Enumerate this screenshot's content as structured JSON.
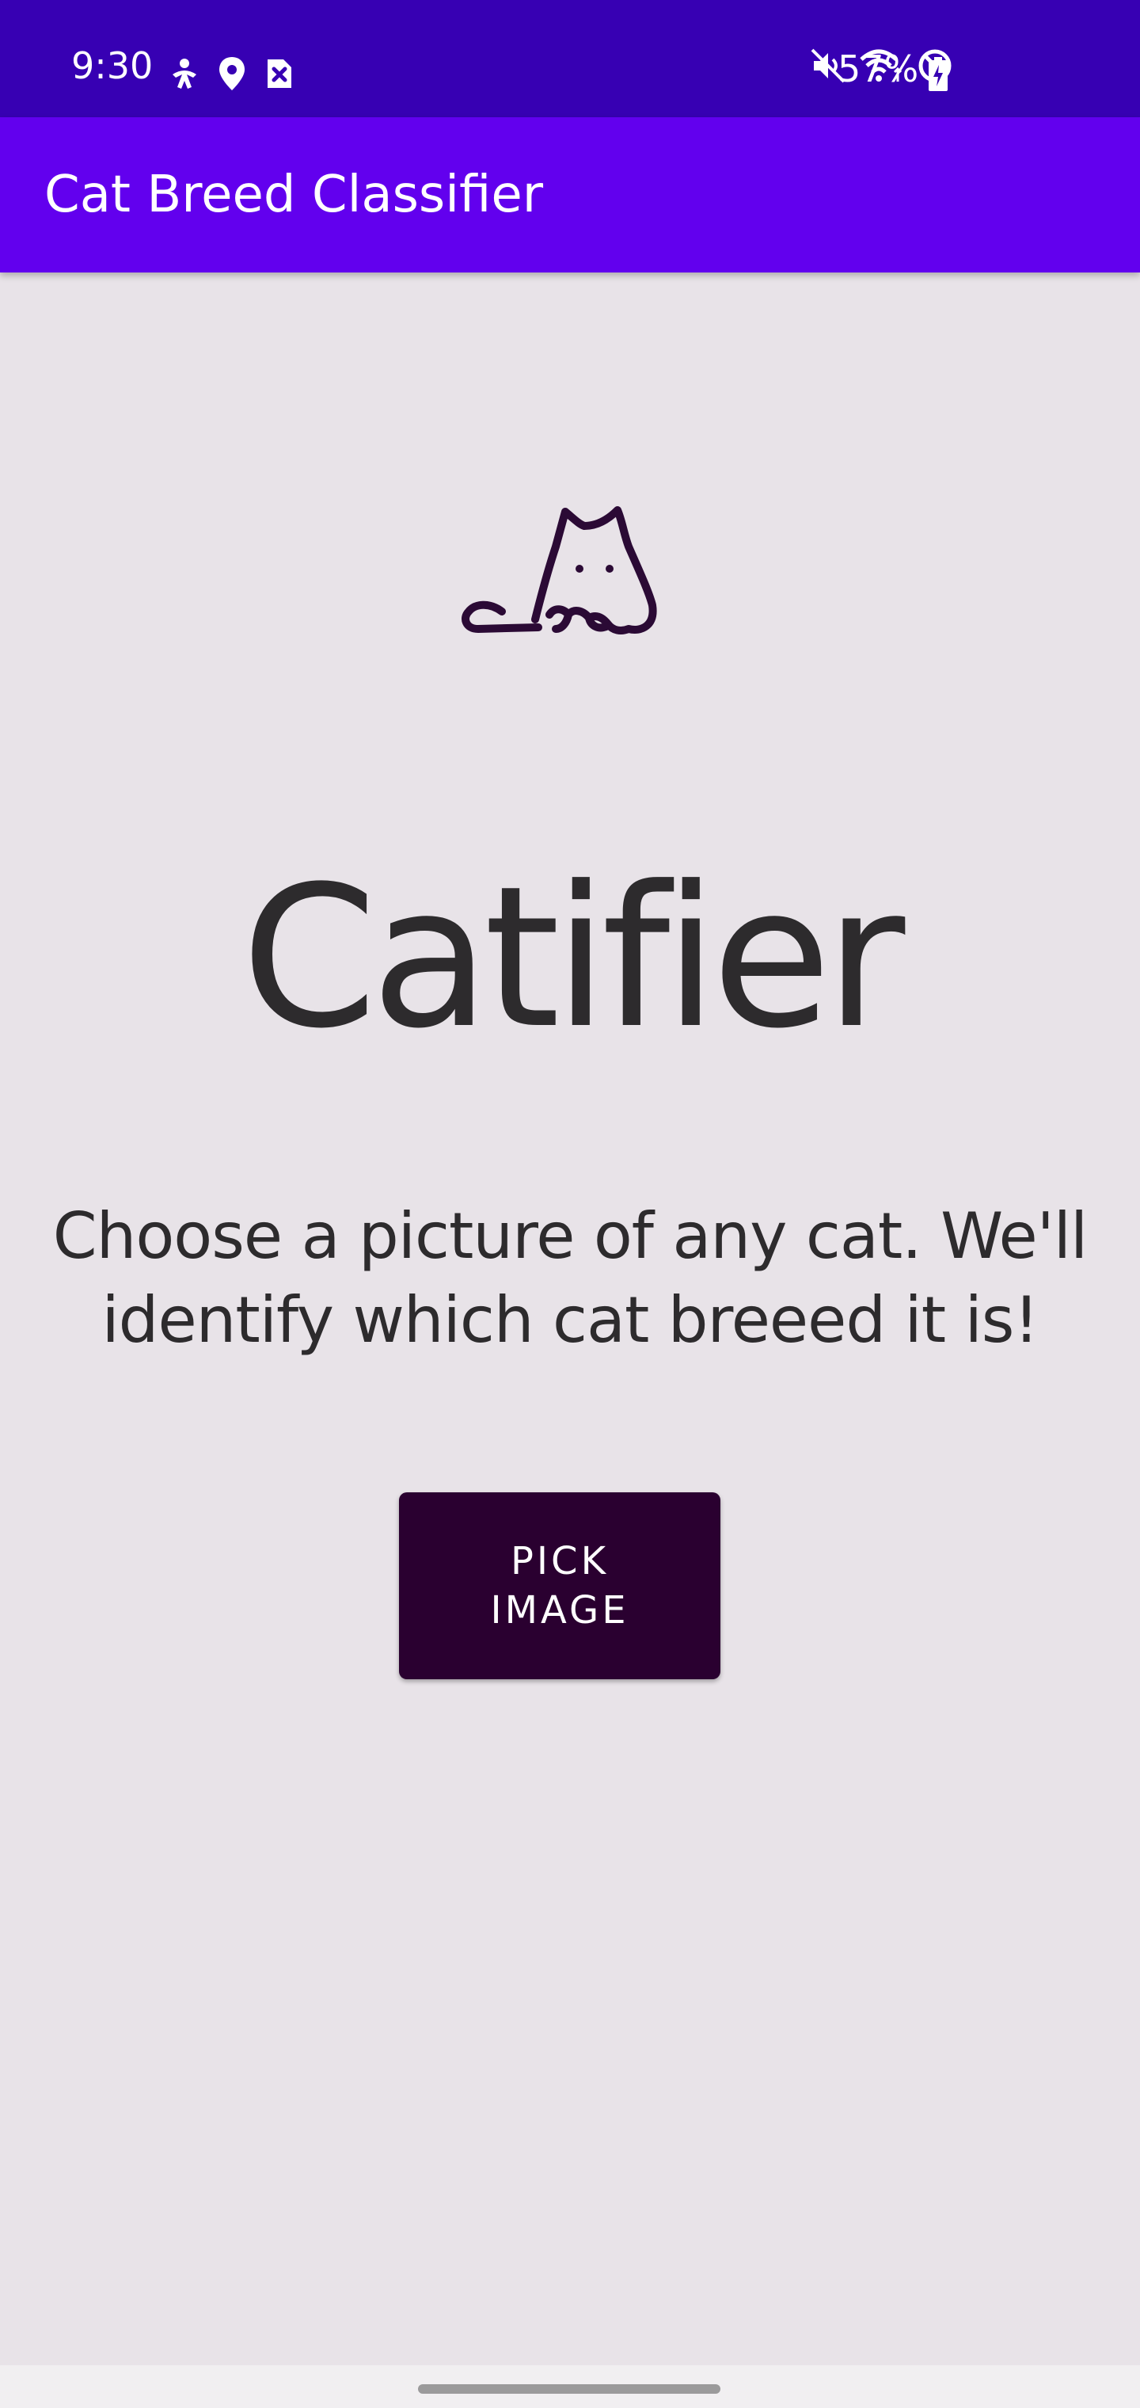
{
  "status_bar": {
    "time": "9:30",
    "left_icons": [
      "accessibility-icon",
      "location-icon",
      "sim-error-icon"
    ],
    "right_icons": [
      "mute-icon",
      "wifi-icon",
      "do-not-disturb-icon"
    ],
    "battery_percent": "57%",
    "background_color": "#3700b3"
  },
  "app_bar": {
    "title": "Cat Breed Classifier",
    "background_color": "#6200ee"
  },
  "main": {
    "logo_icon": "cat-logo-icon",
    "title": "Catifier",
    "description": "Choose a picture of any cat. We'll identify which cat breeed it is!",
    "pick_button_label": "PICK IMAGE",
    "button_color": "#2a0030"
  },
  "nav_bar": {
    "handle": "gesture-handle"
  }
}
